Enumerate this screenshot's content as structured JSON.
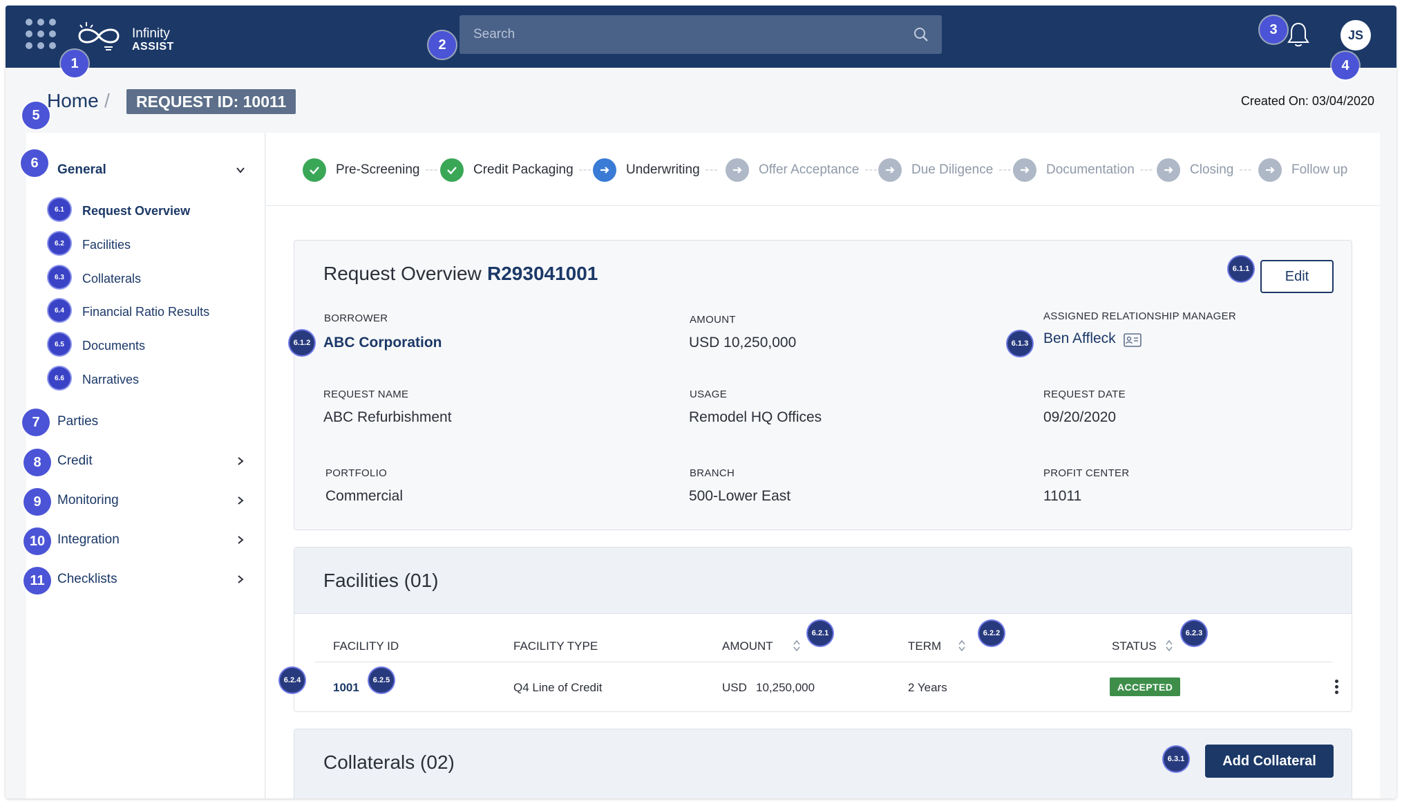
{
  "app": {
    "logo_line1": "Infinity",
    "logo_line2": "ASSIST"
  },
  "search": {
    "placeholder": "Search"
  },
  "user": {
    "initials": "JS"
  },
  "breadcrumb": {
    "home": "Home",
    "separator": "/",
    "current": "REQUEST ID: 10011"
  },
  "created_on": "Created On: 03/04/2020",
  "markers": {
    "m1": "1",
    "m2": "2",
    "m3": "3",
    "m4": "4",
    "m5": "5",
    "m6": "6",
    "m7": "7",
    "m8": "8",
    "m9": "9",
    "m10": "10",
    "m11": "11",
    "s61": "6.1",
    "s62": "6.2",
    "s63": "6.3",
    "s64": "6.4",
    "s65": "6.5",
    "s66": "6.6",
    "k611": "6.1.1",
    "k612": "6.1.2",
    "k613": "6.1.3",
    "k621": "6.2.1",
    "k622": "6.2.2",
    "k623": "6.2.3",
    "k624": "6.2.4",
    "k625": "6.2.5",
    "k631": "6.3.1"
  },
  "sidebar": {
    "general": "General",
    "sub_items": [
      "Request Overview",
      "Facilities",
      "Collaterals",
      "Financial Ratio Results",
      "Documents",
      "Narratives"
    ],
    "parties": "Parties",
    "credit": "Credit",
    "monitoring": "Monitoring",
    "integration": "Integration",
    "checklists": "Checklists"
  },
  "stepper": {
    "dash": "---",
    "steps": [
      {
        "label": "Pre-Screening",
        "state": "done"
      },
      {
        "label": "Credit Packaging",
        "state": "done"
      },
      {
        "label": "Underwriting",
        "state": "current"
      },
      {
        "label": "Offer Acceptance",
        "state": "pending"
      },
      {
        "label": "Due Diligence",
        "state": "pending"
      },
      {
        "label": "Documentation",
        "state": "pending"
      },
      {
        "label": "Closing",
        "state": "pending"
      },
      {
        "label": "Follow up",
        "state": "pending"
      }
    ]
  },
  "overview": {
    "title": "Request Overview",
    "request_code": "R293041001",
    "edit_label": "Edit",
    "borrower_label": "BORROWER",
    "borrower": "ABC Corporation",
    "amount_label": "AMOUNT",
    "amount": "USD 10,250,000",
    "manager_label": "ASSIGNED RELATIONSHIP MANAGER",
    "manager": "Ben Affleck",
    "request_name_label": "REQUEST NAME",
    "request_name": "ABC Refurbishment",
    "usage_label": "USAGE",
    "usage": "Remodel HQ Offices",
    "request_date_label": "REQUEST DATE",
    "request_date": "09/20/2020",
    "portfolio_label": "PORTFOLIO",
    "portfolio": "Commercial",
    "branch_label": "BRANCH",
    "branch": "500-Lower East",
    "profit_center_label": "PROFIT CENTER",
    "profit_center": "11011"
  },
  "facilities": {
    "title": "Facilities (01)",
    "columns": [
      "FACILITY ID",
      "FACILITY TYPE",
      "AMOUNT",
      "TERM",
      "STATUS"
    ],
    "rows": [
      {
        "id": "1001",
        "type": "Q4 Line of Credit",
        "currency": "USD",
        "amount": "10,250,000",
        "term": "2 Years",
        "status": "ACCEPTED"
      }
    ]
  },
  "collaterals": {
    "title": "Collaterals (02)",
    "add_label": "Add Collateral"
  },
  "colors": {
    "header": "#1b3867",
    "accent": "#1b3867",
    "done": "#3aa757",
    "current": "#3a7bd5",
    "pending": "#aeb8c6",
    "accepted": "#3e8e4a",
    "marker": "#4b54d6"
  }
}
